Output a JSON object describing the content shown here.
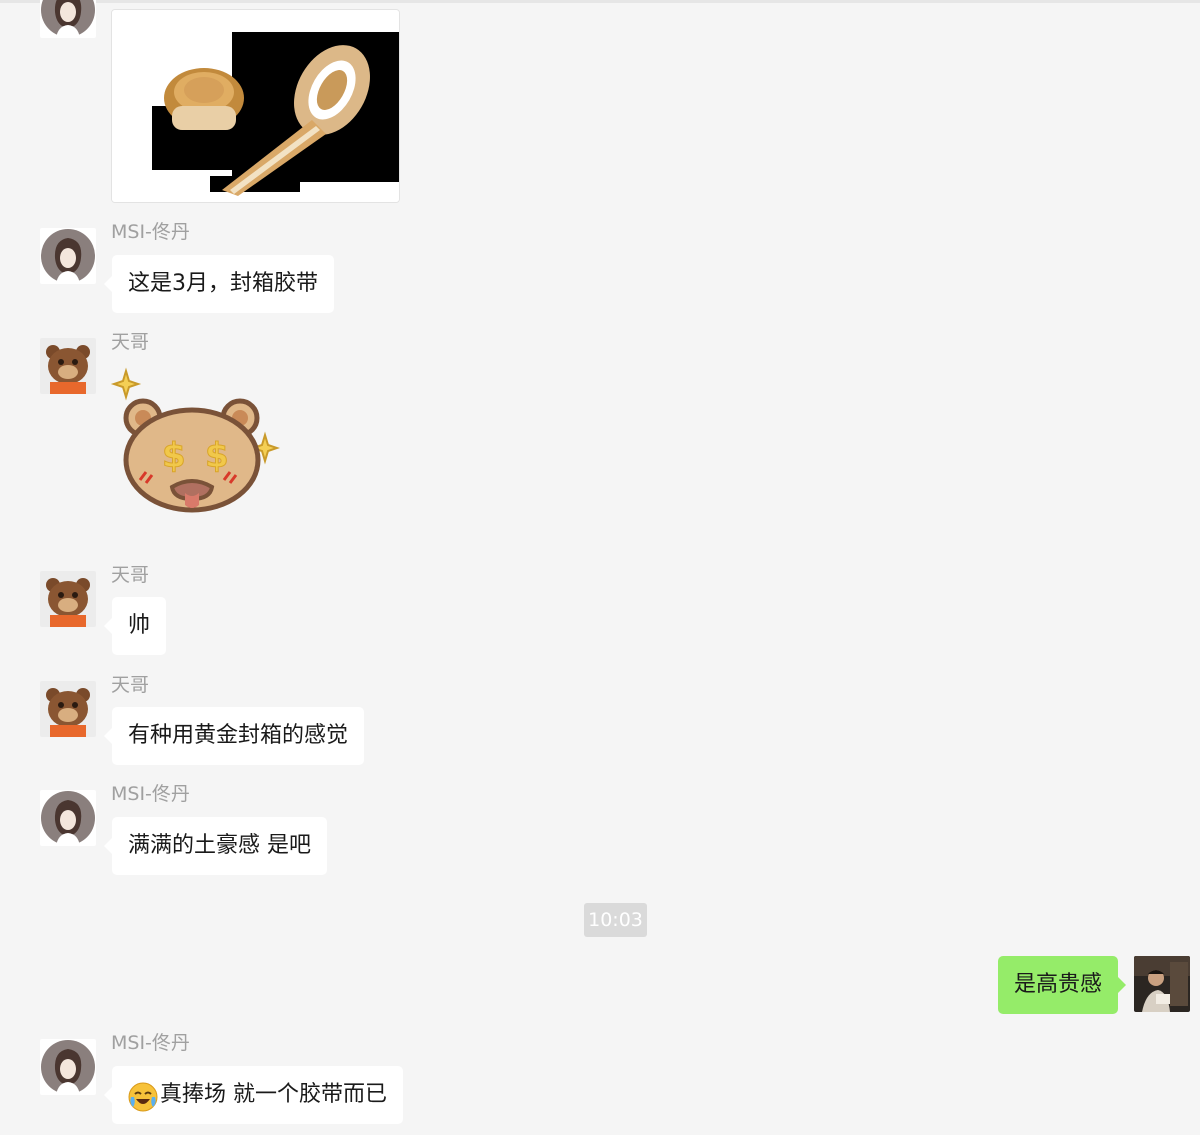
{
  "messages": [
    {
      "sender": "",
      "kind": "image",
      "alt": "tape-image"
    },
    {
      "sender": "MSI-佟丹",
      "kind": "text",
      "text": "这是3月，封箱胶带"
    },
    {
      "sender": "天哥",
      "kind": "sticker",
      "sticker": "bear-money-sticker"
    },
    {
      "sender": "天哥",
      "kind": "text",
      "text": "帅"
    },
    {
      "sender": "天哥",
      "kind": "text",
      "text": "有种用黄金封箱的感觉"
    },
    {
      "sender": "MSI-佟丹",
      "kind": "text",
      "text": "满满的土豪感 是吧"
    },
    {
      "kind": "timestamp",
      "text": "10:03"
    },
    {
      "sender": "self",
      "kind": "text",
      "text": "是高贵感"
    },
    {
      "sender": "MSI-佟丹",
      "kind": "text",
      "emoji": "laughing-crying-emoji",
      "text": "真捧场 就一个胶带而已"
    }
  ],
  "colors": {
    "background": "#f5f5f5",
    "incoming_bubble": "#ffffff",
    "outgoing_bubble": "#95ec69",
    "sender_name": "#a0a0a0",
    "timestamp_bg": "#dadada"
  }
}
